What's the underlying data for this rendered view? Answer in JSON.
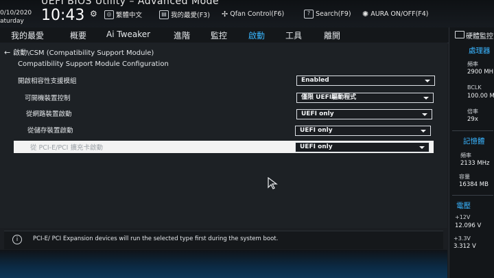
{
  "header": {
    "title": "UEFI BIOS Utility – Advanced Mode",
    "date": "0/10/2020",
    "day": "aturday",
    "time": "10:43",
    "items": [
      {
        "label": "繁體中文",
        "icon": "globe-icon"
      },
      {
        "label": "我的最愛(F3)",
        "icon": "favorites-icon"
      },
      {
        "label": "Qfan Control(F6)",
        "icon": "fan-icon"
      },
      {
        "label": "Search(F9)",
        "icon": "help-icon"
      },
      {
        "label": "AURA ON/OFF(F4)",
        "icon": "aura-icon"
      }
    ]
  },
  "menu": {
    "items": [
      "我的最愛",
      "概要",
      "Ai Tweaker",
      "進階",
      "監控",
      "啟動",
      "工具",
      "離開"
    ],
    "active": "啟動"
  },
  "main": {
    "breadcrumb": "啟動\\CSM (Compatibility Support Module)",
    "section_title": "Compatibility Support Module Configuration",
    "rows": [
      {
        "label": "開啟相容性支援模組",
        "value": "Enabled"
      },
      {
        "label": "可開機裝置控制",
        "value": "僅限 UEFI驅動程式"
      },
      {
        "label": "從網路裝置啟動",
        "value": "UEFI only"
      },
      {
        "label": "從儲存裝置啟動",
        "value": "UEFI only"
      },
      {
        "label": "從 PCI-E/PCI 擴充卡啟動",
        "value": "UEFI only"
      }
    ],
    "info_text": "PCI-E/ PCI Expansion devices will run the selected type first during the system boot."
  },
  "sidebar": {
    "title": "硬體監控",
    "cpu": {
      "heading": "處理器",
      "freq_label": "頻率",
      "freq_value": "2900 MH",
      "bclk_label": "BCLK",
      "bclk_value": "100.00 M",
      "ratio_label": "倍率",
      "ratio_value": "29x"
    },
    "memory": {
      "heading": "記憶體",
      "freq_label": "頻率",
      "freq_value": "2133 MHz",
      "cap_label": "容量",
      "cap_value": "16384 MB"
    },
    "voltage": {
      "heading": "電壓",
      "v12_label": "+12V",
      "v12_value": "12.096 V",
      "v33_label": "+3.3V",
      "v33_value": "3.312 V"
    }
  },
  "colors": {
    "accent": "#38b6ff",
    "background": "#1d2125",
    "highlight_row": "#f3f3f3"
  }
}
